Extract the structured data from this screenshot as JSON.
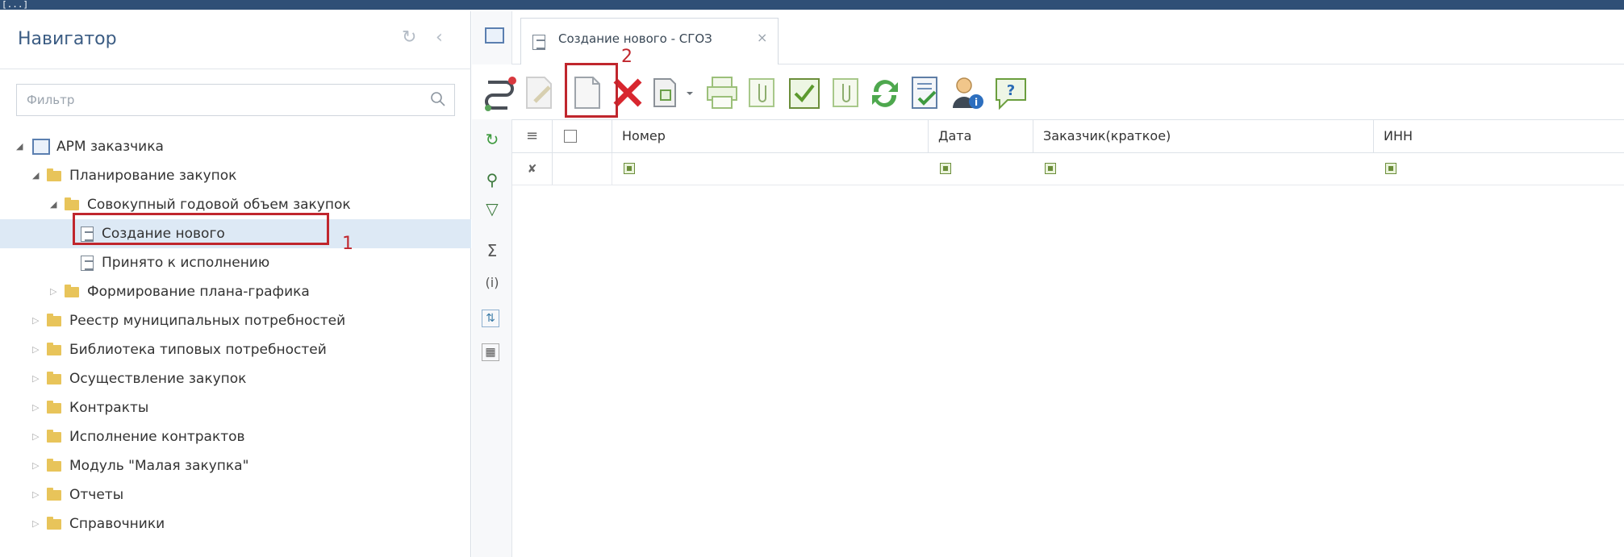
{
  "window": {
    "title_fragment": "[...]"
  },
  "navigator": {
    "title": "Навигатор",
    "filter_placeholder": "Фильтр",
    "tree": [
      {
        "label": "АРМ заказчика",
        "level": 0,
        "expanded": true,
        "icon": "arm-icon"
      },
      {
        "label": "Планирование закупок",
        "level": 1,
        "expanded": true,
        "icon": "folder-icon"
      },
      {
        "label": "Совокупный годовой объем закупок",
        "level": 2,
        "expanded": true,
        "icon": "folder-icon"
      },
      {
        "label": "Создание нового",
        "level": 3,
        "selected": true,
        "icon": "document-icon"
      },
      {
        "label": "Принято к исполнению",
        "level": 3,
        "icon": "document-icon"
      },
      {
        "label": "Формирование плана-графика",
        "level": 2,
        "expanded": false,
        "icon": "folder-icon"
      },
      {
        "label": "Реестр муниципальных потребностей",
        "level": 1,
        "expanded": false,
        "icon": "folder-icon"
      },
      {
        "label": "Библиотека типовых потребностей",
        "level": 1,
        "expanded": false,
        "icon": "folder-icon"
      },
      {
        "label": "Осуществление закупок",
        "level": 1,
        "expanded": false,
        "icon": "folder-icon"
      },
      {
        "label": "Контракты",
        "level": 1,
        "expanded": false,
        "icon": "folder-icon"
      },
      {
        "label": "Исполнение контрактов",
        "level": 1,
        "expanded": false,
        "icon": "folder-icon"
      },
      {
        "label": "Модуль \"Малая закупка\"",
        "level": 1,
        "expanded": false,
        "icon": "folder-icon"
      },
      {
        "label": "Отчеты",
        "level": 1,
        "expanded": false,
        "icon": "folder-icon"
      },
      {
        "label": "Справочники",
        "level": 1,
        "expanded": false,
        "icon": "folder-icon"
      }
    ],
    "annotation_1": "1"
  },
  "tab": {
    "label": "Создание нового - СГОЗ",
    "close": "×"
  },
  "toolbar": {
    "annotation_2": "2"
  },
  "grid": {
    "columns": [
      "Номер",
      "Дата",
      "Заказчик(краткое)",
      "ИНН"
    ]
  },
  "colors": {
    "accent": "#3b5c83",
    "highlight": "#c0262d",
    "selected_row": "#dde9f5"
  }
}
